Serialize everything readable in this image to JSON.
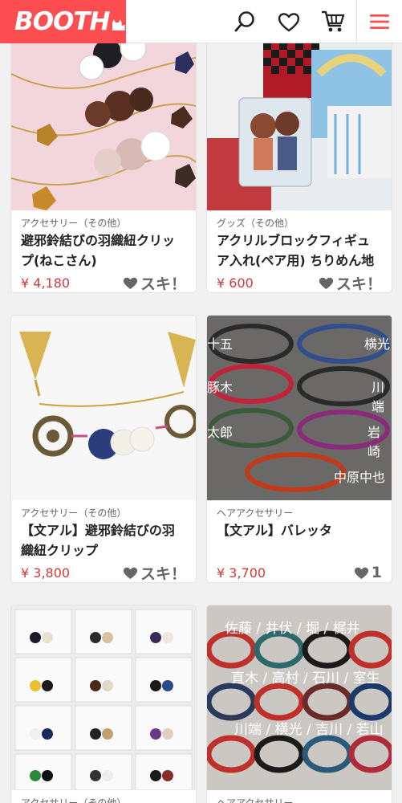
{
  "header": {
    "logo": "BOOTH",
    "icons": [
      "search-icon",
      "heart-icon",
      "cart-icon",
      "menu-icon"
    ],
    "brand_color": "#fc4d50"
  },
  "items": [
    {
      "category": "アクセサリー（その他）",
      "title": "避邪鈴結びの羽織紐クリップ(ねこさん)",
      "price": "¥ 4,180",
      "like": "スキ！"
    },
    {
      "category": "グッズ（その他）",
      "title": "アクリルブロックフィギュア入れ(ペア用) ちりめん地",
      "price": "¥ 600",
      "like": "スキ！"
    },
    {
      "category": "アクセサリー（その他）",
      "title": "【文アル】避邪鈴結びの羽織紐クリップ",
      "price": "¥ 3,800",
      "like": "スキ！"
    },
    {
      "category": "ヘアアクセサリー",
      "title": "【文アル】バレッタ",
      "price": "¥ 3,700",
      "like": "1"
    },
    {
      "category": "アクセサリー（その他）",
      "title": "",
      "price": "",
      "like": ""
    },
    {
      "category": "ヘアアクセサリー",
      "title": "",
      "price": "",
      "like": ""
    }
  ],
  "photo_text": {
    "barrette_names": [
      "十五",
      "横光",
      "豚木",
      "川端",
      "太郎",
      "岩崎",
      "中原中也"
    ],
    "names_photo": [
      "佐藤 / 井伏 / 堀 / 梶井",
      "直木 / 高村 / 石川 / 室生",
      "川端 / 横光 / 吉川 / 若山"
    ]
  }
}
